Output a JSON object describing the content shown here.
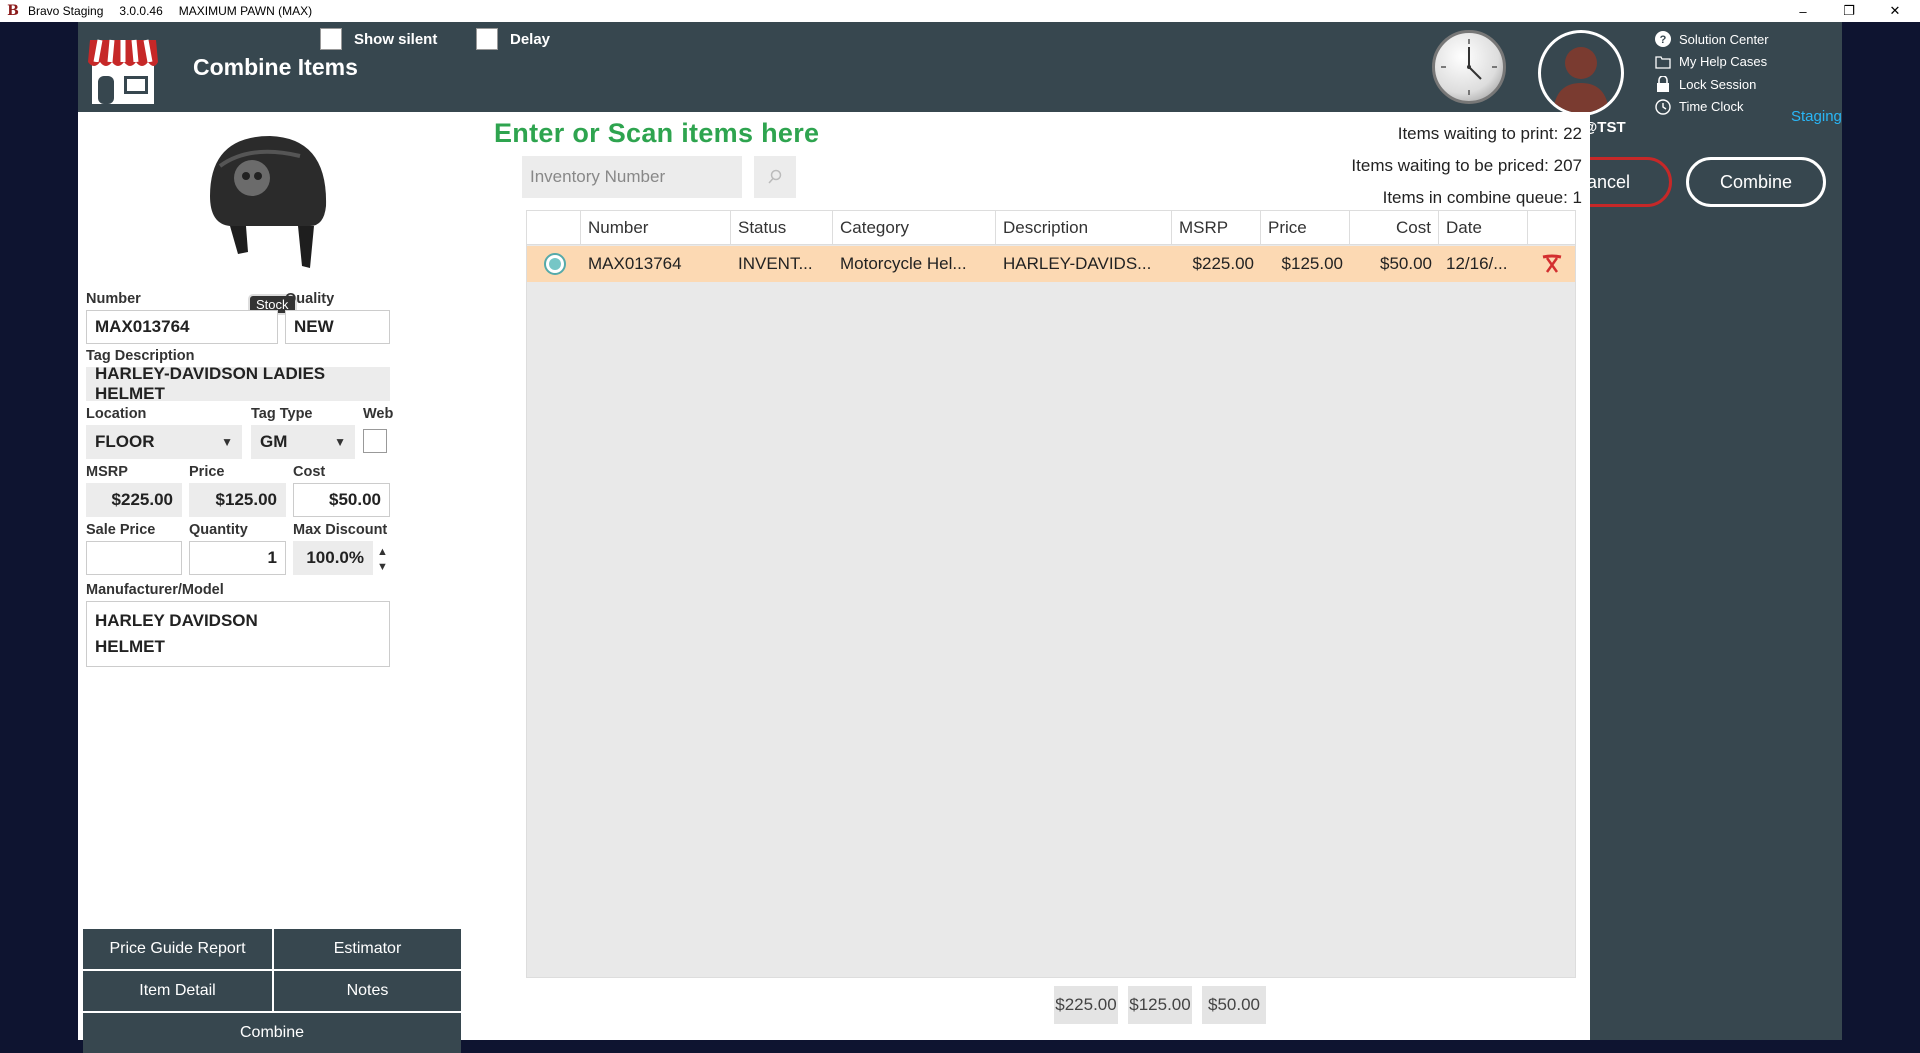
{
  "titlebar": {
    "app_name": "Bravo Staging",
    "version": "3.0.0.46",
    "store": "MAXIMUM PAWN (MAX)",
    "minimize": "–",
    "restore": "❐",
    "close": "✕"
  },
  "header": {
    "title": "Combine Items",
    "show_silent_label": "Show silent",
    "delay_label": "Delay",
    "username": "JOSHR@TST",
    "environment": "Staging",
    "help_links": [
      "Solution Center",
      "My Help Cases",
      "Lock Session",
      "Time Clock"
    ],
    "cancel_label": "Cancel",
    "combine_label": "Combine"
  },
  "item": {
    "stock_badge": "Stock",
    "number_label": "Number",
    "number": "MAX013764",
    "quality_label": "Quality",
    "quality": "NEW",
    "tag_description_label": "Tag Description",
    "tag_description": "HARLEY-DAVIDSON LADIES HELMET",
    "location_label": "Location",
    "location": "FLOOR",
    "tag_type_label": "Tag Type",
    "tag_type": "GM",
    "web_label": "Web",
    "msrp_label": "MSRP",
    "msrp": "$225.00",
    "price_label": "Price",
    "price": "$125.00",
    "cost_label": "Cost",
    "cost": "$50.00",
    "sale_price_label": "Sale Price",
    "sale_price": "",
    "quantity_label": "Quantity",
    "quantity": "1",
    "max_discount_label": "Max Discount",
    "max_discount": "100.0%",
    "manufacturer_label": "Manufacturer/Model",
    "manufacturer_line1": "HARLEY DAVIDSON",
    "manufacturer_line2": "HELMET"
  },
  "actions": {
    "price_guide_report": "Price Guide Report",
    "estimator": "Estimator",
    "item_detail": "Item Detail",
    "notes": "Notes",
    "combine": "Combine"
  },
  "scan": {
    "title": "Enter or Scan items here",
    "placeholder": "Inventory Number",
    "items_waiting_print": "Items waiting to print: 22",
    "items_waiting_priced": "Items waiting to be priced: 207",
    "items_in_queue": "Items in combine queue: 1"
  },
  "grid": {
    "columns": [
      "Number",
      "Status",
      "Category",
      "Description",
      "MSRP",
      "Price",
      "Cost",
      "Date"
    ],
    "rows": [
      {
        "number": "MAX013764",
        "status": "INVENT...",
        "category": "Motorcycle Hel...",
        "description": "HARLEY-DAVIDS...",
        "msrp": "$225.00",
        "price": "$125.00",
        "cost": "$50.00",
        "date": "12/16/..."
      }
    ]
  },
  "totals": {
    "msrp": "$225.00",
    "price": "$125.00",
    "cost": "$50.00"
  },
  "colors": {
    "app_bg": "#37474f",
    "scan_title": "#2ea44f",
    "selected_row": "#fcd9b3",
    "cancel_border": "#c62828",
    "staging": "#29b6f6"
  }
}
